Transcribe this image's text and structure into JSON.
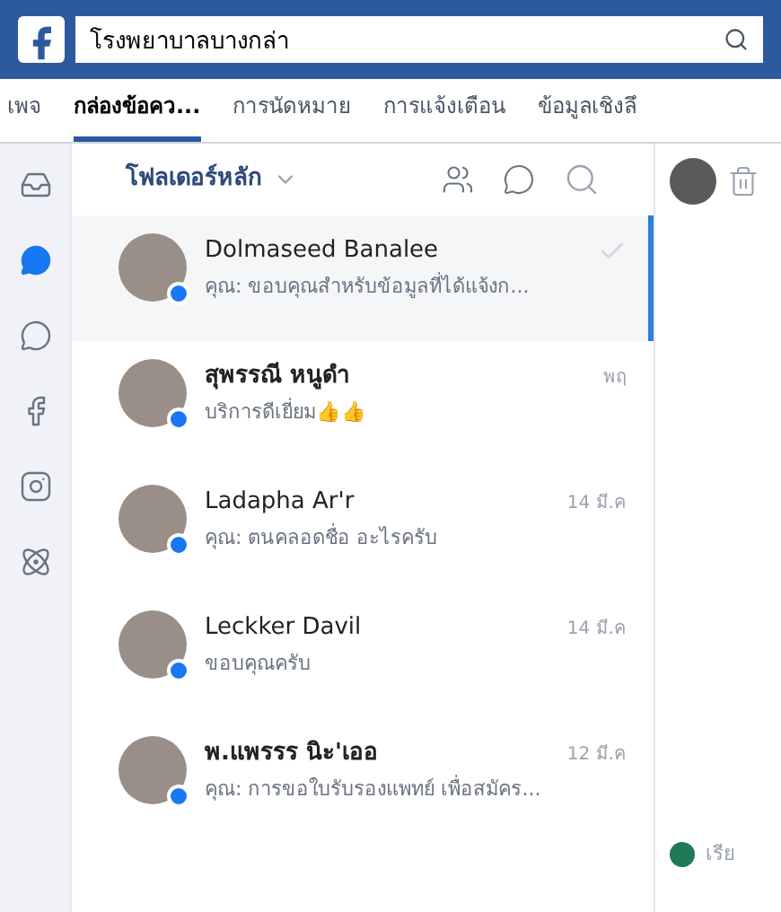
{
  "search": {
    "value": "โรงพยาบาลบางกล่า"
  },
  "tabs": [
    {
      "label": "เพจ",
      "selected": false
    },
    {
      "label": "กล่องข้อคว...",
      "selected": true
    },
    {
      "label": "การนัดหมาย",
      "selected": false
    },
    {
      "label": "การแจ้งเตือน",
      "selected": false
    },
    {
      "label": "ข้อมูลเชิงลึ",
      "selected": false
    }
  ],
  "rail": [
    {
      "kind": "inbox",
      "selected": false
    },
    {
      "kind": "messenger",
      "selected": true
    },
    {
      "kind": "comment",
      "selected": false
    },
    {
      "kind": "facebook",
      "selected": false
    },
    {
      "kind": "instagram",
      "selected": false
    },
    {
      "kind": "apps",
      "selected": false
    }
  ],
  "folder": {
    "label": "โฟลเดอร์หลัก"
  },
  "conversations": [
    {
      "name": "Dolmaseed Banalee",
      "preview": "คุณ: ขอบคุณสำหรับข้อมูลที่ได้แจ้งก...",
      "read": true,
      "selected": true,
      "bold": false
    },
    {
      "name": "สุพรรณี หนูดำ",
      "preview": "บริการดีเยี่ยม👍👍",
      "time": "พฤ",
      "read": false,
      "selected": false,
      "bold": true
    },
    {
      "name": "Ladapha Ar'r",
      "preview": "คุณ: ตนคลอดชื่อ อะไรครับ",
      "time": "14 มี.ค",
      "read": false,
      "selected": false,
      "bold": false
    },
    {
      "name": "Leckker Davil",
      "preview": "ขอบคุณครับ",
      "time": "14 มี.ค",
      "read": false,
      "selected": false,
      "bold": false
    },
    {
      "name": "พ.แพรรร นิะ'เออ",
      "preview": "คุณ: การขอใบรับรองแพทย์ เพื่อสมัคร...",
      "time": "12 มี.ค",
      "read": false,
      "selected": false,
      "bold": true
    }
  ],
  "side_panel": {
    "footer_text": "เรีย"
  }
}
